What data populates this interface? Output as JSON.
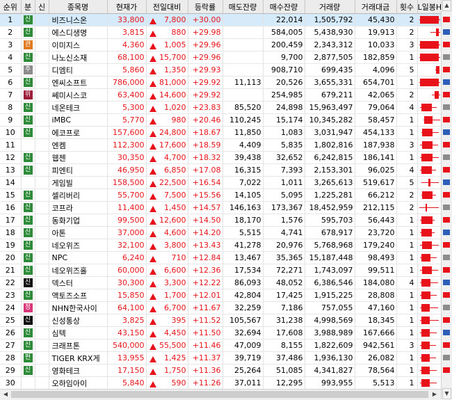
{
  "headers": [
    "순위",
    "분",
    "신",
    "종목명",
    "현재가",
    "전일대비",
    "등락률",
    "매도잔량",
    "매수잔량",
    "거래량",
    "거래대금",
    "횟수",
    "L일봉H"
  ],
  "colors": {
    "up": "#e8131a",
    "selected_row": "#d5ebfb",
    "badge_신": "#2e8b3a",
    "badge_관": "#e07a1e",
    "badge_주": "#8c8c8c",
    "badge_위": "#9b1d3a",
    "badge_정": "#d9367a",
    "badge_신_dark": "#111111",
    "badge_펀": "#2e8b3a"
  },
  "rows": [
    {
      "rank": "1",
      "badge": "신",
      "badge_color": "#2e8b3a",
      "name": "비즈니스온",
      "price": "33,800",
      "change": "7,800",
      "pct": "+30.00",
      "sell": "",
      "buy": "22,014",
      "volume": "1,505,792",
      "amount": "45,430",
      "count": "2"
    },
    {
      "rank": "2",
      "badge": "신",
      "badge_color": "#2e8b3a",
      "name": "에스디생명",
      "price": "3,815",
      "change": "880",
      "pct": "+29.98",
      "sell": "",
      "buy": "584,005",
      "volume": "5,438,930",
      "amount": "19,913",
      "count": "2"
    },
    {
      "rank": "3",
      "badge": "관",
      "badge_color": "#e07a1e",
      "name": "이미지스",
      "price": "4,360",
      "change": "1,005",
      "pct": "+29.96",
      "sell": "",
      "buy": "200,459",
      "volume": "2,343,312",
      "amount": "10,033",
      "count": "3"
    },
    {
      "rank": "4",
      "badge": "신",
      "badge_color": "#2e8b3a",
      "name": "나노신소재",
      "price": "68,100",
      "change": "15,700",
      "pct": "+29.96",
      "sell": "",
      "buy": "9,700",
      "volume": "2,877,505",
      "amount": "182,859",
      "count": "1"
    },
    {
      "rank": "5",
      "badge": "주",
      "badge_color": "#8c8c8c",
      "name": "디엠티",
      "price": "5,860",
      "change": "1,350",
      "pct": "+29.93",
      "sell": "",
      "buy": "908,710",
      "volume": "699,435",
      "amount": "4,096",
      "count": "5"
    },
    {
      "rank": "6",
      "badge": "신",
      "badge_color": "#2e8b3a",
      "name": "엔씨소프트",
      "price": "786,000",
      "change": "81,000",
      "pct": "+29.92",
      "sell": "11,113",
      "buy": "20,526",
      "volume": "3,655,331",
      "amount": "654,701",
      "count": "1"
    },
    {
      "rank": "7",
      "badge": "위",
      "badge_color": "#9b1d3a",
      "name": "쎄미시스코",
      "price": "63,400",
      "change": "14,600",
      "pct": "+29.92",
      "sell": "",
      "buy": "254,985",
      "volume": "679,211",
      "amount": "42,065",
      "count": "2"
    },
    {
      "rank": "8",
      "badge": "신",
      "badge_color": "#2e8b3a",
      "name": "네온테크",
      "price": "5,300",
      "change": "1,020",
      "pct": "+23.83",
      "sell": "85,520",
      "buy": "24,898",
      "volume": "15,963,497",
      "amount": "79,064",
      "count": "4"
    },
    {
      "rank": "9",
      "badge": "신",
      "badge_color": "#2e8b3a",
      "name": "iMBC",
      "price": "5,770",
      "change": "980",
      "pct": "+20.46",
      "sell": "110,245",
      "buy": "15,174",
      "volume": "10,345,282",
      "amount": "58,457",
      "count": "1"
    },
    {
      "rank": "10",
      "badge": "신",
      "badge_color": "#2e8b3a",
      "name": "에코프로",
      "price": "157,600",
      "change": "24,800",
      "pct": "+18.67",
      "sell": "11,850",
      "buy": "1,083",
      "volume": "3,031,947",
      "amount": "454,133",
      "count": "1"
    },
    {
      "rank": "11",
      "badge": "",
      "badge_color": "",
      "name": "엔켐",
      "price": "112,300",
      "change": "17,600",
      "pct": "+18.59",
      "sell": "4,409",
      "buy": "5,835",
      "volume": "1,802,816",
      "amount": "187,938",
      "count": "3"
    },
    {
      "rank": "12",
      "badge": "신",
      "badge_color": "#2e8b3a",
      "name": "웹젠",
      "price": "30,350",
      "change": "4,700",
      "pct": "+18.32",
      "sell": "39,438",
      "buy": "32,652",
      "volume": "6,242,815",
      "amount": "186,141",
      "count": "1"
    },
    {
      "rank": "13",
      "badge": "신",
      "badge_color": "#2e8b3a",
      "name": "피엔티",
      "price": "46,950",
      "change": "6,850",
      "pct": "+17.08",
      "sell": "16,315",
      "buy": "7,393",
      "volume": "2,153,301",
      "amount": "96,025",
      "count": "4"
    },
    {
      "rank": "14",
      "badge": "",
      "badge_color": "",
      "name": "게임빌",
      "price": "158,500",
      "change": "22,500",
      "pct": "+16.54",
      "sell": "7,022",
      "buy": "1,011",
      "volume": "3,265,613",
      "amount": "519,617",
      "count": "5"
    },
    {
      "rank": "15",
      "badge": "신",
      "badge_color": "#2e8b3a",
      "name": "셀리버리",
      "price": "55,700",
      "change": "7,500",
      "pct": "+15.56",
      "sell": "14,105",
      "buy": "5,095",
      "volume": "1,225,281",
      "amount": "66,212",
      "count": "2"
    },
    {
      "rank": "16",
      "badge": "신",
      "badge_color": "#2e8b3a",
      "name": "코프라",
      "price": "11,400",
      "change": "1,450",
      "pct": "+14.57",
      "sell": "146,163",
      "buy": "173,367",
      "volume": "18,452,959",
      "amount": "212,115",
      "count": "2"
    },
    {
      "rank": "17",
      "badge": "신",
      "badge_color": "#2e8b3a",
      "name": "동화기업",
      "price": "99,500",
      "change": "12,600",
      "pct": "+14.50",
      "sell": "18,170",
      "buy": "1,576",
      "volume": "595,703",
      "amount": "56,443",
      "count": "1"
    },
    {
      "rank": "18",
      "badge": "신",
      "badge_color": "#2e8b3a",
      "name": "아톤",
      "price": "37,000",
      "change": "4,600",
      "pct": "+14.20",
      "sell": "5,515",
      "buy": "4,741",
      "volume": "678,917",
      "amount": "23,720",
      "count": "1"
    },
    {
      "rank": "19",
      "badge": "신",
      "badge_color": "#2e8b3a",
      "name": "네오위즈",
      "price": "32,100",
      "change": "3,800",
      "pct": "+13.43",
      "sell": "41,278",
      "buy": "20,976",
      "volume": "5,768,968",
      "amount": "179,240",
      "count": "1"
    },
    {
      "rank": "20",
      "badge": "신",
      "badge_color": "#2e8b3a",
      "name": "NPC",
      "price": "6,240",
      "change": "710",
      "pct": "+12.84",
      "sell": "13,467",
      "buy": "35,365",
      "volume": "15,187,448",
      "amount": "98,493",
      "count": "1"
    },
    {
      "rank": "21",
      "badge": "신",
      "badge_color": "#2e8b3a",
      "name": "네오위즈홀",
      "price": "60,000",
      "change": "6,600",
      "pct": "+12.36",
      "sell": "17,534",
      "buy": "72,271",
      "volume": "1,743,097",
      "amount": "99,511",
      "count": "1"
    },
    {
      "rank": "22",
      "badge": "신",
      "badge_color": "#111111",
      "name": "덱스터",
      "price": "30,300",
      "change": "3,300",
      "pct": "+12.22",
      "sell": "86,093",
      "buy": "48,052",
      "volume": "6,386,546",
      "amount": "184,080",
      "count": "4"
    },
    {
      "rank": "23",
      "badge": "신",
      "badge_color": "#2e8b3a",
      "name": "액토즈소프",
      "price": "15,850",
      "change": "1,700",
      "pct": "+12.01",
      "sell": "42,804",
      "buy": "17,425",
      "volume": "1,915,225",
      "amount": "28,808",
      "count": "1"
    },
    {
      "rank": "24",
      "badge": "정",
      "badge_color": "#d9367a",
      "name": "NHN한국사이",
      "price": "64,100",
      "change": "6,700",
      "pct": "+11.67",
      "sell": "32,259",
      "buy": "7,186",
      "volume": "757,055",
      "amount": "47,160",
      "count": "1"
    },
    {
      "rank": "25",
      "badge": "신",
      "badge_color": "#111111",
      "name": "신성통상",
      "price": "3,825",
      "change": "395",
      "pct": "+11.52",
      "sell": "105,567",
      "buy": "31,238",
      "volume": "4,998,569",
      "amount": "18,345",
      "count": "1"
    },
    {
      "rank": "26",
      "badge": "신",
      "badge_color": "#2e8b3a",
      "name": "심텍",
      "price": "43,150",
      "change": "4,450",
      "pct": "+11.50",
      "sell": "32,694",
      "buy": "17,608",
      "volume": "3,988,989",
      "amount": "167,666",
      "count": "1"
    },
    {
      "rank": "27",
      "badge": "신",
      "badge_color": "#2e8b3a",
      "name": "크래프톤",
      "price": "540,000",
      "change": "55,500",
      "pct": "+11.46",
      "sell": "47,009",
      "buy": "8,155",
      "volume": "1,822,609",
      "amount": "942,561",
      "count": "3"
    },
    {
      "rank": "28",
      "badge": "펀",
      "badge_color": "#2e8b3a",
      "name": "TIGER KRX게",
      "price": "13,955",
      "change": "1,425",
      "pct": "+11.37",
      "sell": "39,719",
      "buy": "37,486",
      "volume": "1,936,130",
      "amount": "26,082",
      "count": "1"
    },
    {
      "rank": "29",
      "badge": "신",
      "badge_color": "#2e8b3a",
      "name": "영화테크",
      "price": "17,150",
      "change": "1,750",
      "pct": "+11.36",
      "sell": "25,264",
      "buy": "51,085",
      "volume": "4,341,827",
      "amount": "78,564",
      "count": "1"
    },
    {
      "rank": "30",
      "badge": "",
      "badge_color": "",
      "name": "오하임아이",
      "price": "5,840",
      "change": "590",
      "pct": "+11.26",
      "sell": "37,011",
      "buy": "12,295",
      "volume": "993,955",
      "amount": "5,513",
      "count": "1"
    }
  ],
  "candles": [
    {
      "l": 0.0,
      "b0": 0.05,
      "b1": 0.95,
      "h": 1.0
    },
    {
      "l": 0.55,
      "b0": 0.8,
      "b1": 0.96,
      "h": 1.0
    },
    {
      "l": 0.0,
      "b0": 0.05,
      "b1": 0.95,
      "h": 1.0
    },
    {
      "l": 0.0,
      "b0": 0.05,
      "b1": 0.95,
      "h": 1.0
    },
    {
      "l": 0.78,
      "b0": 0.82,
      "b1": 0.97,
      "h": 1.0
    },
    {
      "l": 0.0,
      "b0": 0.05,
      "b1": 0.95,
      "h": 1.0
    },
    {
      "l": 0.6,
      "b0": 0.75,
      "b1": 0.95,
      "h": 1.0
    },
    {
      "l": 0.05,
      "b0": 0.1,
      "b1": 0.6,
      "h": 0.85
    },
    {
      "l": 0.2,
      "b0": 0.25,
      "b1": 0.65,
      "h": 1.0
    },
    {
      "l": 0.1,
      "b0": 0.15,
      "b1": 0.65,
      "h": 0.95
    },
    {
      "l": 0.05,
      "b0": 0.15,
      "b1": 0.65,
      "h": 0.9
    },
    {
      "l": 0.05,
      "b0": 0.1,
      "b1": 0.65,
      "h": 0.95
    },
    {
      "l": 0.05,
      "b0": 0.1,
      "b1": 0.6,
      "h": 0.8
    },
    {
      "l": 0.1,
      "b0": 0.45,
      "b1": 0.55,
      "h": 0.95
    },
    {
      "l": 0.1,
      "b0": 0.15,
      "b1": 0.65,
      "h": 0.8
    },
    {
      "l": 0.0,
      "b0": 0.3,
      "b1": 0.35,
      "h": 0.95
    },
    {
      "l": 0.05,
      "b0": 0.1,
      "b1": 0.65,
      "h": 0.75
    },
    {
      "l": 0.05,
      "b0": 0.1,
      "b1": 0.6,
      "h": 0.75
    },
    {
      "l": 0.05,
      "b0": 0.15,
      "b1": 0.6,
      "h": 0.95
    },
    {
      "l": 0.05,
      "b0": 0.1,
      "b1": 0.55,
      "h": 0.85
    },
    {
      "l": 0.05,
      "b0": 0.15,
      "b1": 0.6,
      "h": 0.9
    },
    {
      "l": 0.05,
      "b0": 0.1,
      "b1": 0.55,
      "h": 0.9
    },
    {
      "l": 0.05,
      "b0": 0.1,
      "b1": 0.55,
      "h": 0.85
    },
    {
      "l": 0.05,
      "b0": 0.1,
      "b1": 0.5,
      "h": 0.9
    },
    {
      "l": 0.05,
      "b0": 0.1,
      "b1": 0.5,
      "h": 0.95
    },
    {
      "l": 0.05,
      "b0": 0.1,
      "b1": 0.5,
      "h": 0.85
    },
    {
      "l": 0.05,
      "b0": 0.1,
      "b1": 0.5,
      "h": 0.8
    },
    {
      "l": 0.05,
      "b0": 0.1,
      "b1": 0.5,
      "h": 0.8
    },
    {
      "l": 0.05,
      "b0": 0.1,
      "b1": 0.5,
      "h": 0.85
    },
    {
      "l": 0.05,
      "b0": 0.1,
      "b1": 0.5,
      "h": 0.85
    }
  ],
  "scrollbar_marks": [
    "#e8131a",
    "#2e5fb8",
    "#e8131a",
    "#8c8c8c",
    "#e8131a",
    "#2e5fb8",
    "#e8131a",
    "#8c8c8c",
    "#e8131a",
    "#2e5fb8",
    "#e8131a",
    "#8c8c8c",
    "#e8131a",
    "#2e5fb8",
    "#e8131a",
    "#8c8c8c",
    "#e8131a",
    "#2e5fb8",
    "#e8131a",
    "#8c8c8c",
    "#e8131a",
    "#2e5fb8",
    "#e8131a",
    "#8c8c8c",
    "#e8131a",
    "#2e5fb8",
    "#e8131a",
    "#8c8c8c",
    "#e8131a"
  ]
}
